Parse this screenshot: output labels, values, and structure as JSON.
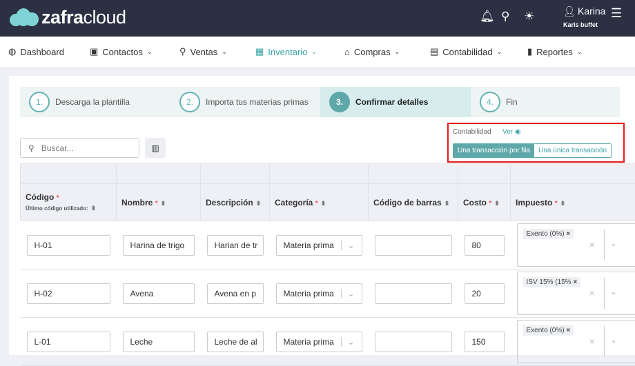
{
  "brand": {
    "bold": "zafra",
    "light": "cloud"
  },
  "user": {
    "name": "Karina",
    "business": "Karis buffet"
  },
  "nav": [
    {
      "label": "Dashboard",
      "icon": "dashboard-icon"
    },
    {
      "label": "Contactos",
      "icon": "contacts-icon"
    },
    {
      "label": "Ventas",
      "icon": "sales-icon"
    },
    {
      "label": "Inventario",
      "icon": "inventory-icon",
      "active": true
    },
    {
      "label": "Compras",
      "icon": "store-icon"
    },
    {
      "label": "Contabilidad",
      "icon": "calculator-icon"
    },
    {
      "label": "Reportes",
      "icon": "chart-icon"
    }
  ],
  "steps": [
    {
      "num": "1.",
      "label": "Descarga la plantilla"
    },
    {
      "num": "2.",
      "label": "Importa tus materias primas"
    },
    {
      "num": "3.",
      "label": "Confirmar detalles"
    },
    {
      "num": "4.",
      "label": "Fin"
    }
  ],
  "search": {
    "placeholder": "Buscar..."
  },
  "accounting": {
    "label": "Contabilidad",
    "view": "Ver",
    "option_per_row": "Una transacción por fila",
    "option_single": "Una única transacción"
  },
  "table": {
    "headers": {
      "code": "Código",
      "code_sub": "Último código utilizado:",
      "name": "Nombre",
      "description": "Descripción",
      "category": "Categoría",
      "barcode": "Código de barras",
      "cost": "Costo",
      "tax": "Impuesto"
    },
    "rows": [
      {
        "code": "H-01",
        "name": "Harina de trigo",
        "description": "Harian de tr",
        "category": "Materia prima",
        "barcode": "",
        "cost": "80",
        "tax": "Exento  (0%)"
      },
      {
        "code": "H-02",
        "name": "Avena",
        "description": "Avena en p",
        "category": "Materia prima",
        "barcode": "",
        "cost": "20",
        "tax": "ISV 15%  (15%"
      },
      {
        "code": "L-01",
        "name": "Leche",
        "description": "Leche de al",
        "category": "Materia prima",
        "barcode": "",
        "cost": "150",
        "tax": "Exento  (0%)"
      }
    ]
  }
}
